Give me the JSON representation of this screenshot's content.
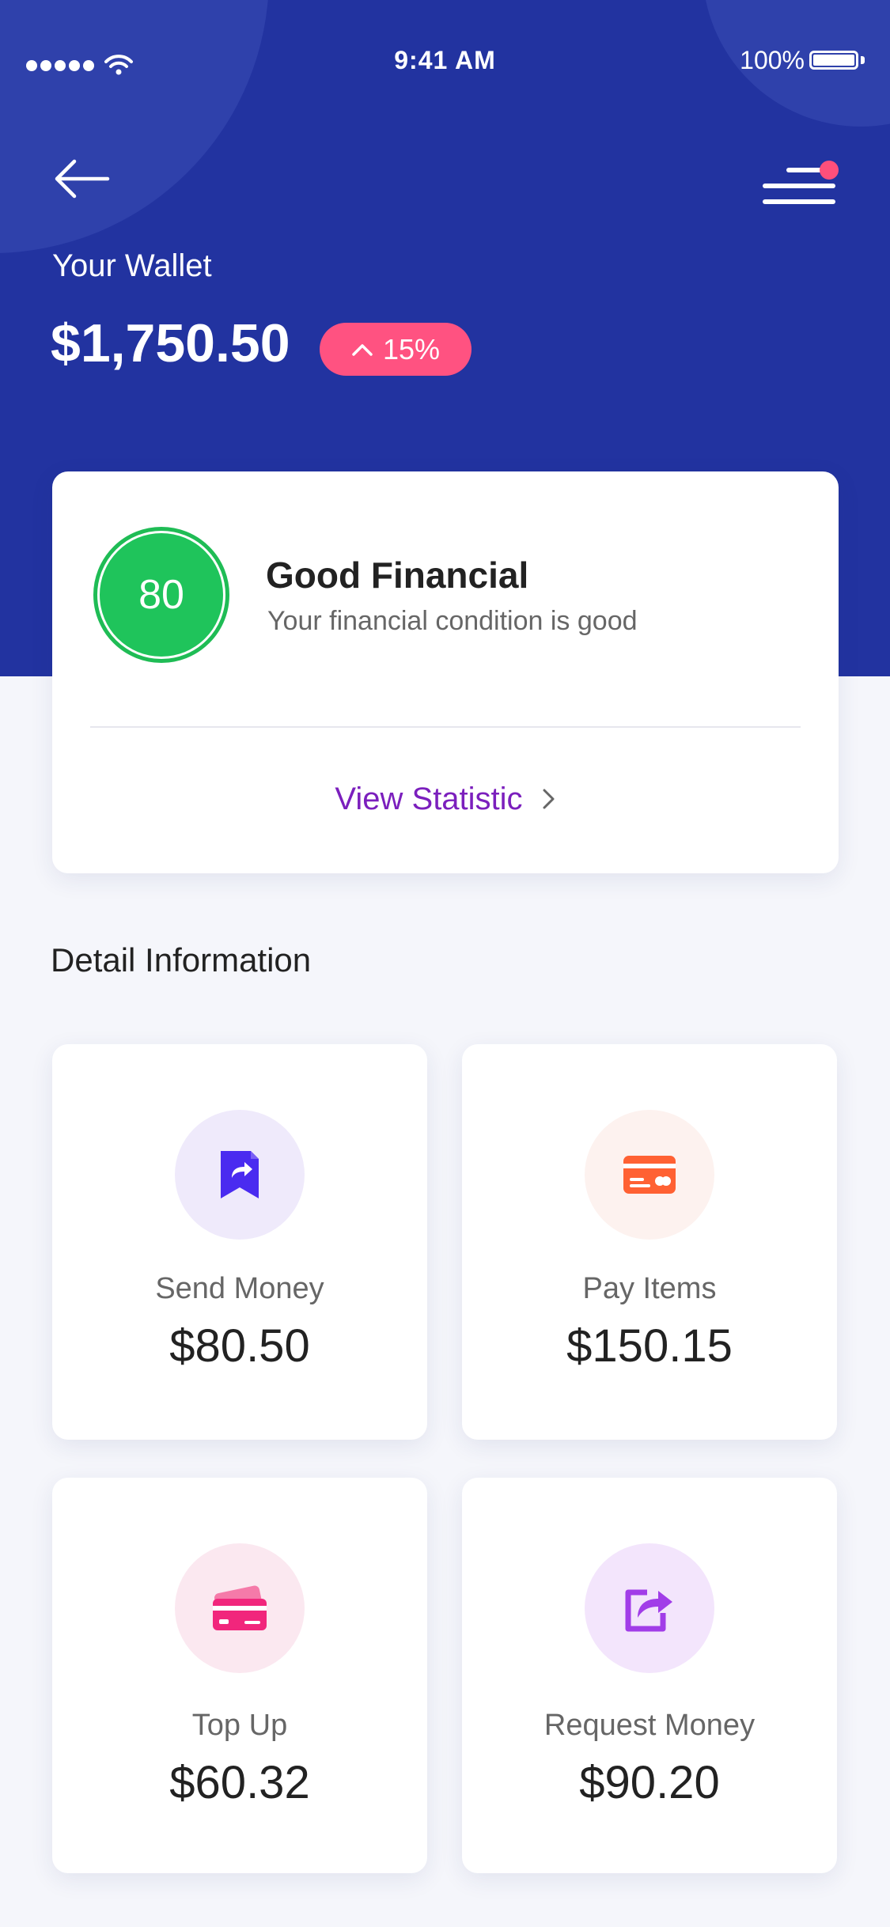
{
  "status_bar": {
    "time": "9:41 AM",
    "battery": "100%"
  },
  "header": {
    "wallet_label": "Your Wallet",
    "balance": "$1,750.50",
    "change_badge": "15%"
  },
  "score_card": {
    "score": "80",
    "title": "Good Financial",
    "subtitle": "Your financial condition is good",
    "link": "View Statistic"
  },
  "section_title": "Detail Information",
  "tiles": [
    {
      "label": "Send Money",
      "amount": "$80.50",
      "icon": "bookmark-share-icon",
      "color": "#4a2bf0",
      "bg": "#efeafb"
    },
    {
      "label": "Pay Items",
      "amount": "$150.15",
      "icon": "credit-card-icon",
      "color": "#ff6133",
      "bg": "#fdf2ef"
    },
    {
      "label": "Top Up",
      "amount": "$60.32",
      "icon": "cards-icon",
      "color": "#f1267c",
      "bg": "#fbe8f0"
    },
    {
      "label": "Request Money",
      "amount": "$90.20",
      "icon": "share-box-icon",
      "color": "#a13de8",
      "bg": "#f3e5fc"
    }
  ],
  "colors": {
    "header_bg": "#2233a0",
    "accent_pink": "#ff5281",
    "score_green": "#1fc45b",
    "link_purple": "#7b1fbd"
  }
}
